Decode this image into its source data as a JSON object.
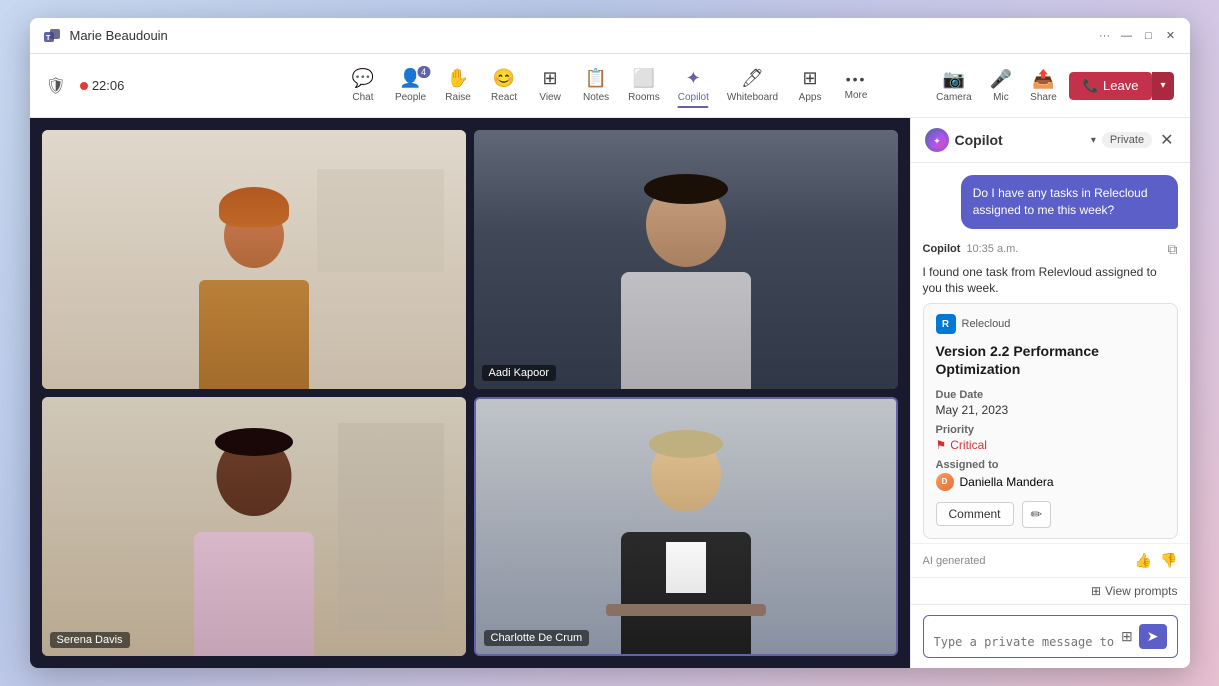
{
  "window": {
    "title": "Marie Beaudouin",
    "logo": "teams-logo"
  },
  "title_bar": {
    "controls": [
      "more-options",
      "minimize",
      "maximize",
      "close"
    ]
  },
  "toolbar": {
    "left": {
      "shield_label": "",
      "recording_time": "22:06"
    },
    "center_items": [
      {
        "id": "chat",
        "label": "Chat",
        "icon": "💬",
        "active": false,
        "badge": null
      },
      {
        "id": "people",
        "label": "People",
        "icon": "👤",
        "active": false,
        "badge": "4"
      },
      {
        "id": "raise",
        "label": "Raise",
        "icon": "✋",
        "active": false,
        "badge": null
      },
      {
        "id": "react",
        "label": "React",
        "icon": "😊",
        "active": false,
        "badge": null
      },
      {
        "id": "view",
        "label": "View",
        "icon": "⊞",
        "active": false,
        "badge": null
      },
      {
        "id": "notes",
        "label": "Notes",
        "icon": "📋",
        "active": false,
        "badge": null
      },
      {
        "id": "rooms",
        "label": "Rooms",
        "icon": "⬜",
        "active": false,
        "badge": null
      },
      {
        "id": "copilot",
        "label": "Copilot",
        "icon": "✦",
        "active": true,
        "badge": null
      },
      {
        "id": "whiteboard",
        "label": "Whiteboard",
        "icon": "◻",
        "active": false,
        "badge": null
      },
      {
        "id": "apps",
        "label": "Apps",
        "icon": "⊞",
        "active": false,
        "badge": null
      },
      {
        "id": "more",
        "label": "More",
        "icon": "···",
        "active": false,
        "badge": null
      }
    ],
    "right_items": [
      {
        "id": "camera",
        "label": "Camera",
        "icon": "📷"
      },
      {
        "id": "mic",
        "label": "Mic",
        "icon": "🎤"
      },
      {
        "id": "share",
        "label": "Share",
        "icon": "📤"
      }
    ],
    "leave_button": "Leave"
  },
  "video_participants": [
    {
      "id": "p1",
      "name": "",
      "position": "top-left",
      "active_speaker": false
    },
    {
      "id": "p2",
      "name": "Aadi Kapoor",
      "position": "top-right",
      "active_speaker": false
    },
    {
      "id": "p3",
      "name": "Serena Davis",
      "position": "bottom-left",
      "active_speaker": false
    },
    {
      "id": "p4",
      "name": "Charlotte De Crum",
      "position": "bottom-right",
      "active_speaker": true
    }
  ],
  "copilot_panel": {
    "title": "Copilot",
    "dropdown_label": "▾",
    "private_badge": "Private",
    "close_label": "✕",
    "conversation": [
      {
        "type": "user",
        "text": "Do I have any tasks in Relecloud assigned to me this week?"
      },
      {
        "type": "bot",
        "sender": "Copilot",
        "time": "10:35 a.m.",
        "has_copy_icon": true,
        "text": "I found one task from Relevloud assigned to you this week.",
        "task_card": {
          "app_name": "Relecloud",
          "app_icon": "R",
          "title": "Version 2.2 Performance Optimization",
          "due_date_label": "Due Date",
          "due_date": "May 21, 2023",
          "priority_label": "Priority",
          "priority": "Critical",
          "assigned_to_label": "Assigned to",
          "assigned_to": "Daniella Mandera",
          "comment_btn": "Comment",
          "edit_icon": "✏"
        }
      }
    ],
    "ai_generated_label": "AI generated",
    "view_prompts_label": "View prompts",
    "input_placeholder": "Type a private message to Copilot"
  }
}
